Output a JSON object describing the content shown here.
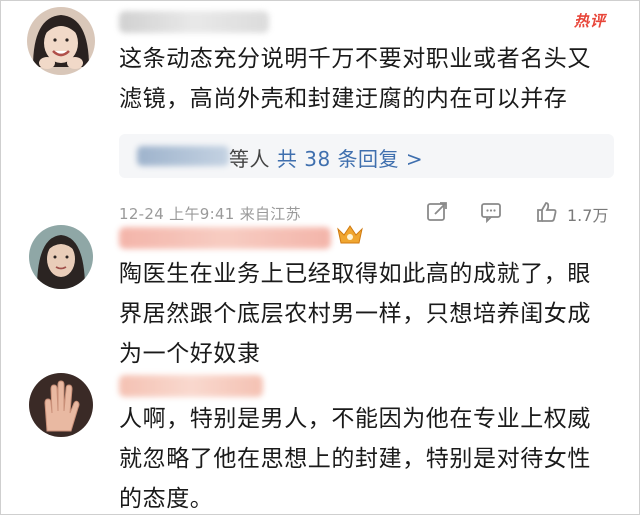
{
  "comments": [
    {
      "avatar": "woman-smiling-avatar",
      "text_lines": [
        "这条动态充分说明千万不要对职业或者名头又",
        "滤镜，高尚外壳和封建迂腐的内在可以并存"
      ],
      "badge": "热评",
      "reply": {
        "suffix": "等人 ",
        "count_link": "共 38 条回复 >"
      },
      "meta": {
        "time": "12-24 上午9:41 来自江苏",
        "likes": "1.7万"
      }
    },
    {
      "avatar": "woman-portrait-avatar",
      "text_lines": [
        "陶医生在业务上已经取得如此高的成就了，眼",
        "界居然跟个底层农村男一样，只想培养闺女成",
        "为一个好奴隶"
      ]
    },
    {
      "avatar": "hand-wave-avatar",
      "text_lines": [
        "人啊，特别是男人，不能因为他在专业上权威",
        "就忽略了他在思想上的封建，特别是对待女性",
        "的态度。"
      ]
    }
  ],
  "icons": {
    "share": "share-icon",
    "comment": "comment-icon",
    "like": "thumbs-up-icon",
    "vip": "vip-badge-icon"
  },
  "colors": {
    "hot_badge": "#e8463a",
    "link": "#3f6fae",
    "meta": "#9a9a9a",
    "reply_bg": "#f5f6f8"
  }
}
